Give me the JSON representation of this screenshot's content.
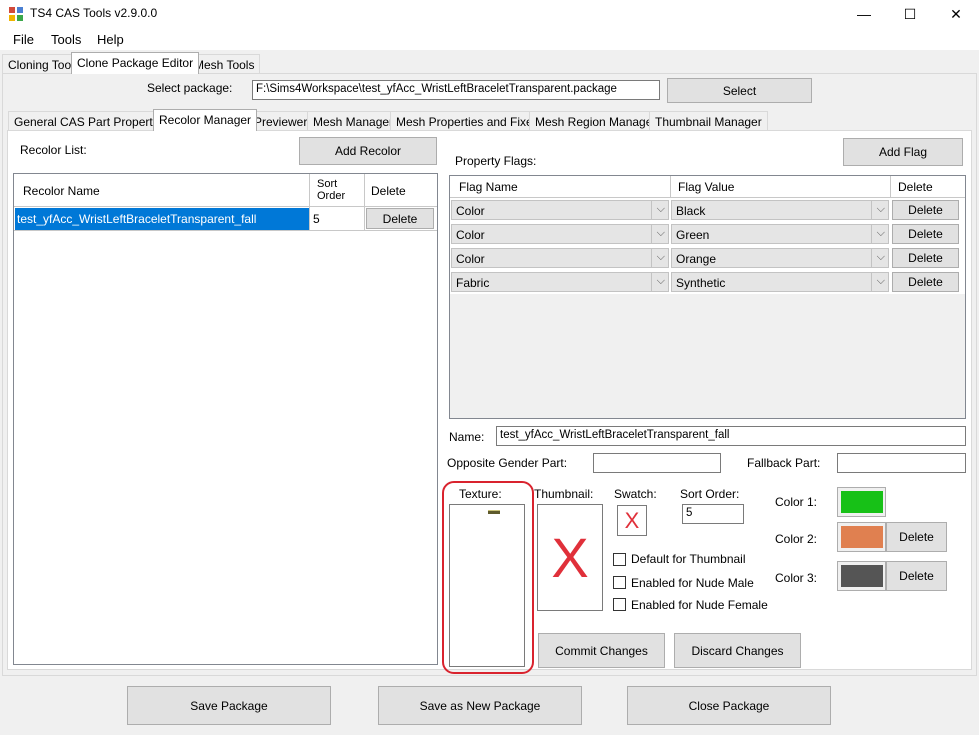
{
  "window": {
    "title": "TS4 CAS Tools v2.9.0.0",
    "minimize": "—",
    "maximize": "☐",
    "close": "✕"
  },
  "menu": [
    "File",
    "Tools",
    "Help"
  ],
  "top_tabs": [
    "Cloning Tool",
    "Clone Package Editor",
    "Mesh Tools"
  ],
  "package": {
    "label": "Select package:",
    "path": "F:\\Sims4Workspace\\test_yfAcc_WristLeftBraceletTransparent.package",
    "select_button": "Select"
  },
  "sub_tabs": [
    "General CAS Part Properties",
    "Recolor Manager",
    "Previewer",
    "Mesh Manager",
    "Mesh Properties and Fixers",
    "Mesh Region Manager",
    "Thumbnail Manager"
  ],
  "recolor": {
    "list_label": "Recolor List:",
    "add_button": "Add Recolor",
    "columns": [
      "Recolor Name",
      "Sort\nOrder",
      "Delete"
    ],
    "rows": [
      {
        "name": "test_yfAcc_WristLeftBraceletTransparent_fall",
        "sort": "5",
        "delete": "Delete"
      }
    ]
  },
  "flags": {
    "label": "Property Flags:",
    "add_button": "Add Flag",
    "columns": [
      "Flag Name",
      "Flag Value",
      "Delete"
    ],
    "rows": [
      {
        "name": "Color",
        "value": "Black",
        "delete": "Delete"
      },
      {
        "name": "Color",
        "value": "Green",
        "delete": "Delete"
      },
      {
        "name": "Color",
        "value": "Orange",
        "delete": "Delete"
      },
      {
        "name": "Fabric",
        "value": "Synthetic",
        "delete": "Delete"
      }
    ]
  },
  "details": {
    "name_label": "Name:",
    "name_value": "test_yfAcc_WristLeftBraceletTransparent_fall",
    "opposite_label": "Opposite Gender Part:",
    "opposite_value": "",
    "fallback_label": "Fallback Part:",
    "fallback_value": "",
    "texture_label": "Texture:",
    "thumbnail_label": "Thumbnail:",
    "thumbnail_missing": "X",
    "swatch_label": "Swatch:",
    "swatch_missing": "X",
    "sort_label": "Sort Order:",
    "sort_value": "5",
    "checkboxes": [
      "Default for Thumbnail",
      "Enabled for Nude Male",
      "Enabled for Nude Female"
    ],
    "commit_button": "Commit Changes",
    "discard_button": "Discard Changes",
    "colors": [
      {
        "label": "Color 1:",
        "hex": "#17c117",
        "delete": ""
      },
      {
        "label": "Color 2:",
        "hex": "#e08050",
        "delete": "Delete"
      },
      {
        "label": "Color 3:",
        "hex": "#555555",
        "delete": "Delete"
      }
    ],
    "highlight_color": "#d9232e"
  },
  "footer": {
    "save": "Save Package",
    "save_as": "Save as New Package",
    "close": "Close Package"
  }
}
